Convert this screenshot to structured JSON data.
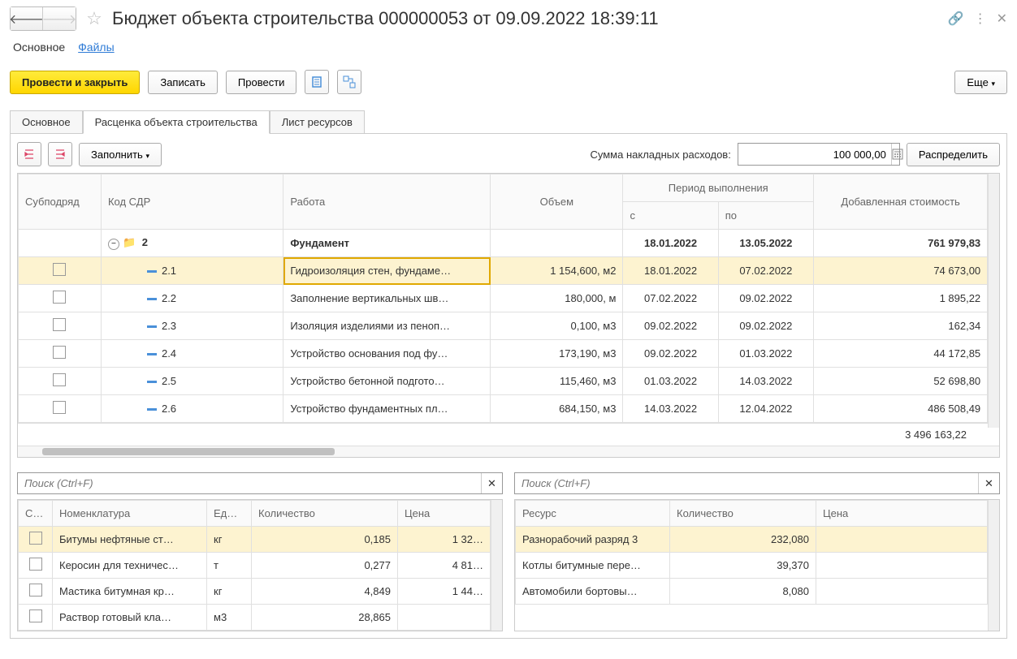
{
  "title": "Бюджет объекта строительства 000000053 от 09.09.2022 18:39:11",
  "mainTabs": {
    "main": "Основное",
    "files": "Файлы"
  },
  "toolbar": {
    "postClose": "Провести и закрыть",
    "save": "Записать",
    "post": "Провести",
    "more": "Еще"
  },
  "subtabs": {
    "main": "Основное",
    "rates": "Расценка объекта строительства",
    "resources": "Лист ресурсов"
  },
  "panel": {
    "fill": "Заполнить",
    "overheadLabel": "Сумма накладных расходов:",
    "overheadValue": "100 000,00",
    "distribute": "Распределить"
  },
  "gridHeaders": {
    "subcontract": "Субподряд",
    "code": "Код СДР",
    "work": "Работа",
    "volume": "Объем",
    "period": "Период выполнения",
    "from": "с",
    "to": "по",
    "added": "Добавленная стоимость"
  },
  "gridRows": [
    {
      "type": "folder",
      "code": "2",
      "work": "Фундамент",
      "from": "18.01.2022",
      "to": "13.05.2022",
      "added": "761 979,83"
    },
    {
      "type": "item",
      "code": "2.1",
      "work": "Гидроизоляция стен, фундаме…",
      "volume": "1 154,600, м2",
      "from": "18.01.2022",
      "to": "07.02.2022",
      "added": "74 673,00",
      "selected": true
    },
    {
      "type": "item",
      "code": "2.2",
      "work": "Заполнение вертикальных шв…",
      "volume": "180,000, м",
      "from": "07.02.2022",
      "to": "09.02.2022",
      "added": "1 895,22"
    },
    {
      "type": "item",
      "code": "2.3",
      "work": "Изоляция изделиями из пеноп…",
      "volume": "0,100, м3",
      "from": "09.02.2022",
      "to": "09.02.2022",
      "added": "162,34"
    },
    {
      "type": "item",
      "code": "2.4",
      "work": "Устройство основания под фу…",
      "volume": "173,190, м3",
      "from": "09.02.2022",
      "to": "01.03.2022",
      "added": "44 172,85"
    },
    {
      "type": "item",
      "code": "2.5",
      "work": "Устройство бетонной подгото…",
      "volume": "115,460, м3",
      "from": "01.03.2022",
      "to": "14.03.2022",
      "added": "52 698,80"
    },
    {
      "type": "item",
      "code": "2.6",
      "work": "Устройство фундаментных пл…",
      "volume": "684,150, м3",
      "from": "14.03.2022",
      "to": "12.04.2022",
      "added": "486 508,49"
    }
  ],
  "gridTotal": "3 496 163,22",
  "search": {
    "placeholder": "Поиск (Ctrl+F)"
  },
  "leftGrid": {
    "headers": {
      "sub": "С…",
      "nomen": "Номенклатура",
      "unit": "Ед…",
      "qty": "Количество",
      "price": "Цена"
    },
    "rows": [
      {
        "nomen": "Битумы нефтяные ст…",
        "unit": "кг",
        "qty": "0,185",
        "price": "1 32…",
        "selected": true
      },
      {
        "nomen": "Керосин для техничес…",
        "unit": "т",
        "qty": "0,277",
        "price": "4 81…"
      },
      {
        "nomen": "Мастика битумная кр…",
        "unit": "кг",
        "qty": "4,849",
        "price": "1 44…"
      },
      {
        "nomen": "Раствор готовый кла…",
        "unit": "м3",
        "qty": "28,865",
        "price": ""
      }
    ]
  },
  "rightGrid": {
    "headers": {
      "resource": "Ресурс",
      "qty": "Количество",
      "price": "Цена"
    },
    "rows": [
      {
        "resource": "Разнорабочий разряд 3",
        "qty": "232,080",
        "price": "",
        "selected": true
      },
      {
        "resource": "Котлы битумные пере…",
        "qty": "39,370",
        "price": ""
      },
      {
        "resource": "Автомобили бортовы…",
        "qty": "8,080",
        "price": ""
      }
    ]
  }
}
